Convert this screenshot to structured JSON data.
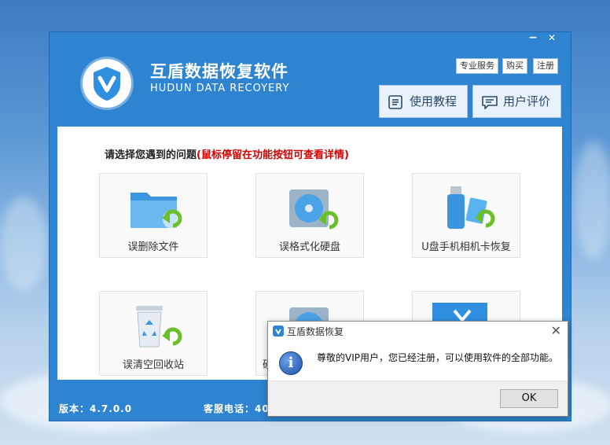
{
  "app": {
    "title": "互盾数据恢复软件",
    "subtitle": "HUDUN DATA RECOYERY",
    "controls": {
      "minimize": "−",
      "close": "✕"
    },
    "top_links": [
      "专业服务",
      "购买",
      "注册"
    ],
    "buttons": {
      "tutorial": "使用教程",
      "review": "用户评价"
    },
    "prompt": {
      "main": "请选择您遇到的问题",
      "hint": "(鼠标停留在功能按钮可查看详情)"
    },
    "tiles": [
      {
        "label": "误删除文件",
        "icon": "folder-restore-icon"
      },
      {
        "label": "误格式化硬盘",
        "icon": "harddisk-restore-icon"
      },
      {
        "label": "U盘手机相机卡恢复",
        "icon": "usb-card-restore-icon"
      },
      {
        "label": "误清空回收站",
        "icon": "recycle-bin-restore-icon"
      },
      {
        "label": "硬",
        "icon": "partition-restore-icon"
      },
      {
        "label": "",
        "icon": "more-tool-icon"
      }
    ],
    "status": {
      "version": "版本：4.7.0.0",
      "phone": "客服电话：400"
    }
  },
  "dialog": {
    "title": "互盾数据恢复",
    "message": "尊敬的VIP用户，您已经注册，可以使用软件的全部功能。",
    "ok_label": "OK",
    "close": "✕",
    "icon": "info-icon"
  },
  "colors": {
    "window": "#2e84d0",
    "accent_red": "#d40000",
    "icon_blue": "#4aa3e6",
    "arrow_green": "#6abf2a"
  }
}
